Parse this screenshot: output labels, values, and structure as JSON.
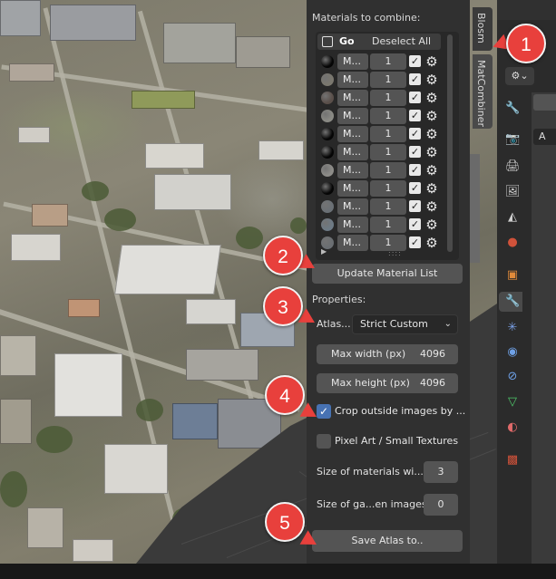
{
  "panel": {
    "materials_heading": "Materials to combine:",
    "header": {
      "go_label": "Go",
      "deselect_label": "Deselect All"
    },
    "materials": [
      {
        "name": "M...",
        "count": "1",
        "checked": true,
        "color": "#050505"
      },
      {
        "name": "M...",
        "count": "1",
        "checked": true,
        "color": "#7a776e"
      },
      {
        "name": "M...",
        "count": "1",
        "checked": true,
        "color": "#5a4f4a"
      },
      {
        "name": "M...",
        "count": "1",
        "checked": true,
        "color": "#8a8a84"
      },
      {
        "name": "M...",
        "count": "1",
        "checked": true,
        "color": "#050505"
      },
      {
        "name": "M...",
        "count": "1",
        "checked": true,
        "color": "#050505"
      },
      {
        "name": "M...",
        "count": "1",
        "checked": true,
        "color": "#8d8c88"
      },
      {
        "name": "M...",
        "count": "1",
        "checked": true,
        "color": "#050505"
      },
      {
        "name": "M...",
        "count": "1",
        "checked": true,
        "color": "#6a7075"
      },
      {
        "name": "M...",
        "count": "1",
        "checked": true,
        "color": "#6d7a85"
      },
      {
        "name": "M...",
        "count": "1",
        "checked": true,
        "color": "#6a6e72"
      }
    ],
    "update_button": "Update Material List",
    "properties_heading": "Properties:",
    "atlas": {
      "label": "Atlas...",
      "value": "Strict Custom"
    },
    "max_width": {
      "label": "Max width (px)",
      "value": "4096"
    },
    "max_height": {
      "label": "Max height (px)",
      "value": "4096"
    },
    "crop": {
      "label": "Crop outside images by ...",
      "checked": true
    },
    "pixel_art": {
      "label": "Pixel Art / Small Textures",
      "checked": false
    },
    "size_materials": {
      "label": "Size of materials wi...",
      "value": "3"
    },
    "size_gaps": {
      "label": "Size of ga...en images",
      "value": "0"
    },
    "save_button": "Save Atlas to.."
  },
  "tabs": {
    "blosm": "Blosm",
    "matcombiner": "MatCombiner"
  },
  "props": {
    "field_text": "A"
  },
  "callouts": [
    "1",
    "2",
    "3",
    "4",
    "5"
  ]
}
